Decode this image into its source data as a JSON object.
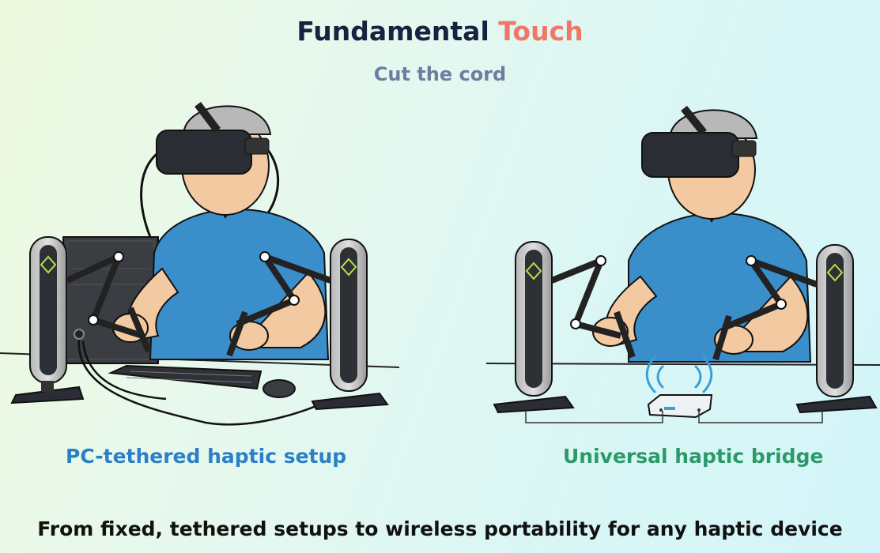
{
  "header": {
    "title_main": "Fundamental ",
    "title_accent": "Touch",
    "subtitle": "Cut the cord"
  },
  "panels": {
    "left_label": "PC-tethered haptic setup",
    "right_label": "Universal haptic bridge"
  },
  "caption": "From fixed, tethered setups to wireless portability for any haptic device",
  "colors": {
    "title": "#18213d",
    "accent": "#f07868",
    "subtitle": "#6d7da0",
    "left_label": "#2b7fc7",
    "right_label": "#2b9a68",
    "shirt": "#3a8fcb",
    "skin": "#f2c9a0",
    "wifi": "#3a9fd6"
  }
}
